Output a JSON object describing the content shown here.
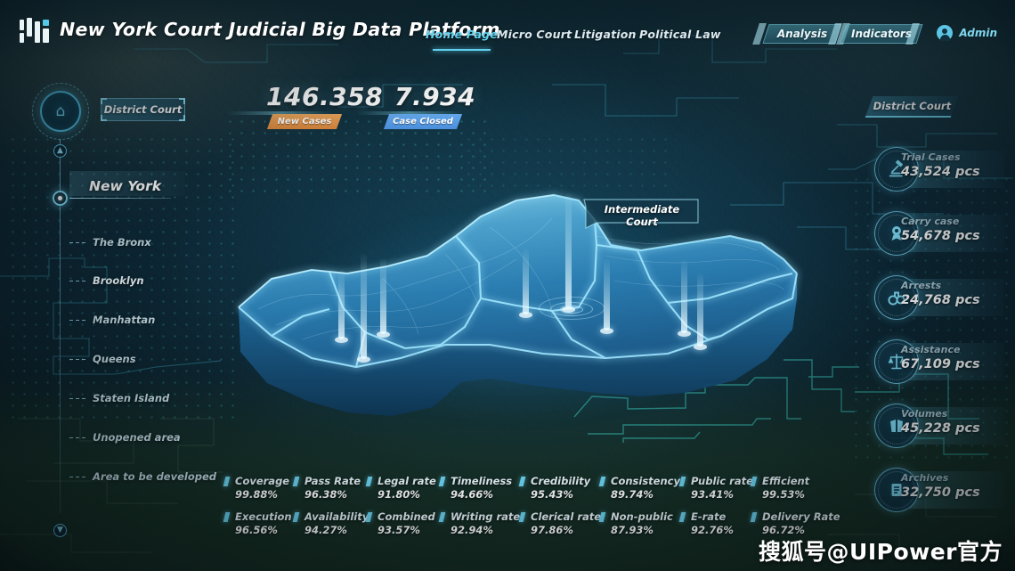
{
  "header": {
    "brand": "New York Court Judicial Big Data Platform",
    "logo_icon": "bars-logo-icon",
    "nav": [
      {
        "label": "Home Page",
        "active": true
      },
      {
        "label": "Micro Court",
        "active": false
      },
      {
        "label": "Litigation",
        "active": false
      },
      {
        "label": "Political Law",
        "active": false
      }
    ],
    "actions": [
      {
        "label": "Analysis"
      },
      {
        "label": "Indicators"
      }
    ],
    "user": {
      "name": "Admin",
      "icon": "user-avatar-icon"
    },
    "accent_color": "#5fd0ee"
  },
  "top_stats": [
    {
      "value": "146.358",
      "tag": "New Cases",
      "tag_color": "#d8853b"
    },
    {
      "value": "7.934",
      "tag": "Case Closed",
      "tag_color": "#4b8fdc"
    }
  ],
  "left_panel": {
    "home_icon": "home-icon",
    "up_icon": "↑",
    "down_icon": "↓",
    "court_chip": "District Court",
    "selected_region": "New York",
    "districts": [
      {
        "label": "The Bronx",
        "bright": false
      },
      {
        "label": "Brooklyn",
        "bright": true
      },
      {
        "label": "Manhattan",
        "bright": false
      },
      {
        "label": "Queens",
        "bright": false
      },
      {
        "label": "Staten Island",
        "bright": false
      },
      {
        "label": "Unopened area",
        "bright": false
      },
      {
        "label": "Area to be developed",
        "bright": false
      }
    ]
  },
  "map": {
    "marker_label": "Intermediate Court"
  },
  "right_panel": {
    "chip": "District Court",
    "cards": [
      {
        "name": "Trial Cases",
        "value": "43,524 pcs",
        "icon": "gavel-icon"
      },
      {
        "name": "Carry case",
        "value": "54,678 pcs",
        "icon": "award-badge-icon"
      },
      {
        "name": "Arrests",
        "value": "24,768 pcs",
        "icon": "handcuffs-icon"
      },
      {
        "name": "Assistance",
        "value": "67,109 pcs",
        "icon": "scales-icon"
      },
      {
        "name": "Volumes",
        "value": "45,228 pcs",
        "icon": "books-icon"
      },
      {
        "name": "Archives",
        "value": "32,750 pcs",
        "icon": "archive-scroll-icon"
      }
    ]
  },
  "metrics": {
    "row1": [
      {
        "name": "Coverage",
        "value": "99.88%"
      },
      {
        "name": "Pass Rate",
        "value": "96.38%"
      },
      {
        "name": "Legal rate",
        "value": "91.80%"
      },
      {
        "name": "Timeliness",
        "value": "94.66%"
      },
      {
        "name": "Credibility",
        "value": "95.43%"
      },
      {
        "name": "Consistency",
        "value": "89.74%"
      },
      {
        "name": "Public rate",
        "value": "93.41%"
      },
      {
        "name": "Efficient",
        "value": "99.53%"
      }
    ],
    "row2": [
      {
        "name": "Execution",
        "value": "96.56%"
      },
      {
        "name": "Availability",
        "value": "94.27%"
      },
      {
        "name": "Combined",
        "value": "93.57%"
      },
      {
        "name": "Writing rate",
        "value": "92.94%"
      },
      {
        "name": "Clerical rate",
        "value": "97.86%"
      },
      {
        "name": "Non-public",
        "value": "87.93%"
      },
      {
        "name": "E-rate",
        "value": "92.76%"
      },
      {
        "name": "Delivery Rate",
        "value": "96.72%"
      }
    ]
  },
  "watermark": "搜狐号@UIPower官方"
}
